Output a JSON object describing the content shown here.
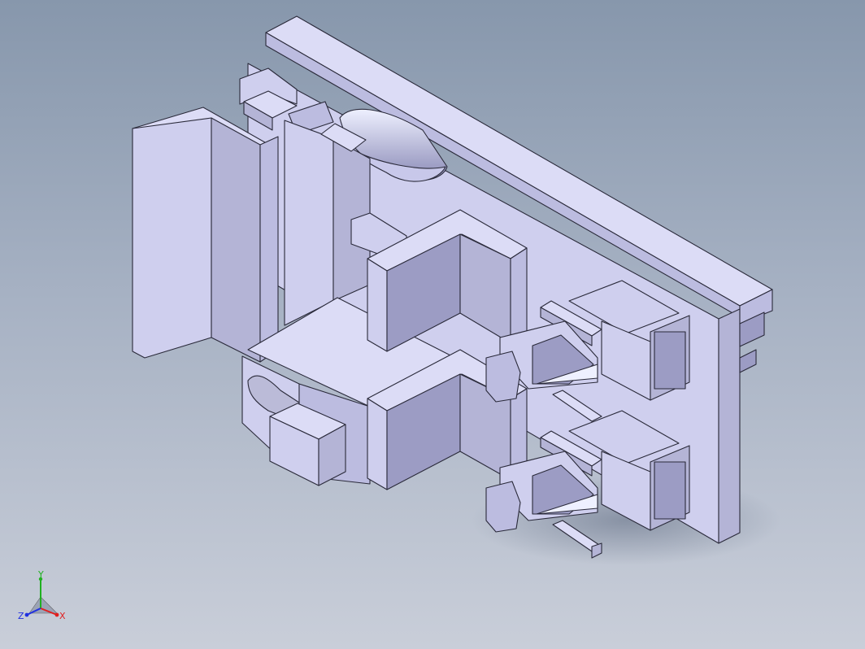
{
  "triad": {
    "x_label": "X",
    "y_label": "Y",
    "z_label": "Z",
    "x_color": "#e02020",
    "y_color": "#20b020",
    "z_color": "#2030e0"
  },
  "colors": {
    "background_top": "#8797ac",
    "background_bottom": "#c9ced9",
    "part_light": "#dcdcf6",
    "part_shadow": "#9c9cc4",
    "edge": "#2a2a3a"
  }
}
